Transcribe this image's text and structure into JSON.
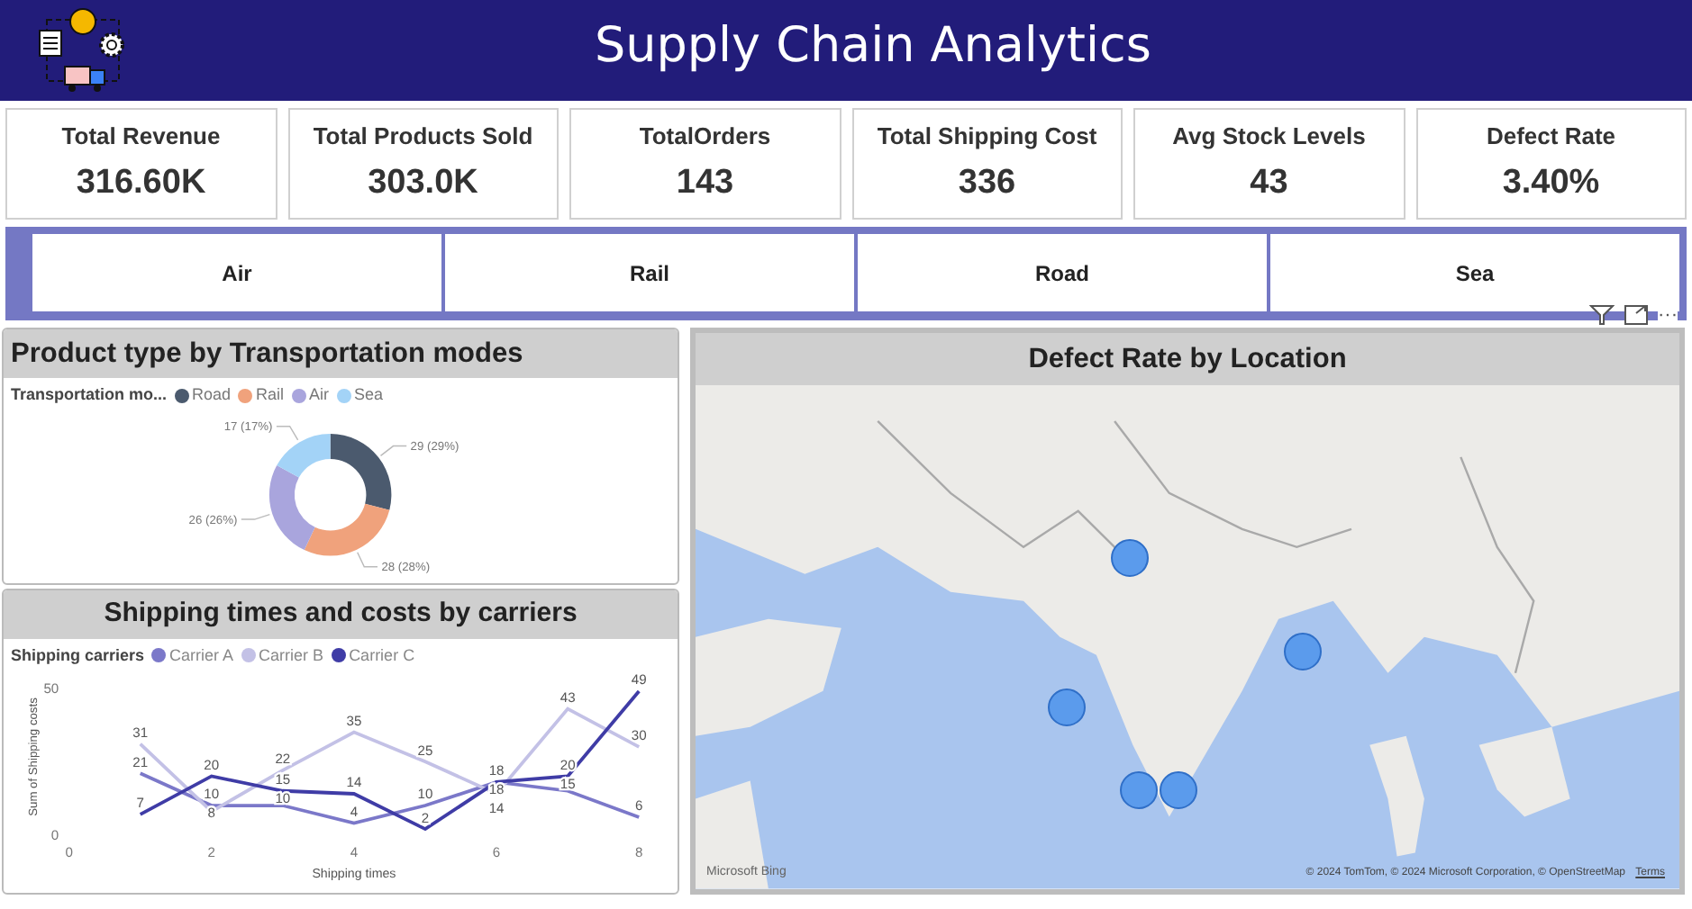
{
  "header": {
    "title": "Supply Chain Analytics"
  },
  "kpis": [
    {
      "label": "Total Revenue",
      "value": "316.60K"
    },
    {
      "label": "Total Products Sold",
      "value": "303.0K"
    },
    {
      "label": "TotalOrders",
      "value": "143"
    },
    {
      "label": "Total Shipping Cost",
      "value": "336"
    },
    {
      "label": "Avg Stock Levels",
      "value": "43"
    },
    {
      "label": "Defect Rate",
      "value": "3.40%"
    }
  ],
  "slicer": [
    {
      "label": "Air",
      "selected": false
    },
    {
      "label": "Rail",
      "selected": false
    },
    {
      "label": "Road",
      "selected": false
    },
    {
      "label": "Sea",
      "selected": false
    }
  ],
  "visual_header": {
    "more": "···"
  },
  "donut_panel": {
    "title": "Product type by Transportation modes",
    "legend_title": "Transportation mo...",
    "chart_data": {
      "type": "donut",
      "categories": [
        "Road",
        "Rail",
        "Air",
        "Sea"
      ],
      "series": [
        {
          "values": [
            29,
            28,
            26,
            17
          ]
        }
      ],
      "colors": [
        "#4b5a6e",
        "#f0a27c",
        "#a9a5dd",
        "#a3d3f7"
      ],
      "value_labels": [
        "29 (29%)",
        "28 (28%)",
        "26 (26%)",
        "17 (17%)"
      ]
    }
  },
  "line_panel": {
    "title": "Shipping times and costs by carriers",
    "legend_title": "Shipping carriers",
    "chart_data": {
      "type": "line",
      "xlabel": "Shipping times",
      "ylabel": "Sum of Shipping costs",
      "x": [
        1,
        2,
        3,
        4,
        5,
        6,
        7,
        8
      ],
      "series": [
        {
          "name": "Carrier A",
          "color": "#7b78c9",
          "values": [
            21,
            10,
            10,
            4,
            10,
            18,
            15,
            6
          ]
        },
        {
          "name": "Carrier B",
          "color": "#c3c1e6",
          "values": [
            31,
            8,
            22,
            35,
            25,
            14,
            43,
            30
          ]
        },
        {
          "name": "Carrier C",
          "color": "#3f3ca6",
          "values": [
            7,
            20,
            15,
            14,
            2,
            18,
            20,
            49
          ]
        }
      ],
      "xlim": [
        0,
        8
      ],
      "ylim": [
        0,
        50
      ],
      "xticks": [
        0,
        2,
        4,
        6,
        8
      ],
      "yticks": [
        0,
        50
      ],
      "data_labels": true
    }
  },
  "map_panel": {
    "title": "Defect Rate by Location",
    "logo": "Microsoft Bing",
    "attribution": "© 2024 TomTom, © 2024 Microsoft Corporation, © OpenStreetMap",
    "terms": "Terms"
  }
}
